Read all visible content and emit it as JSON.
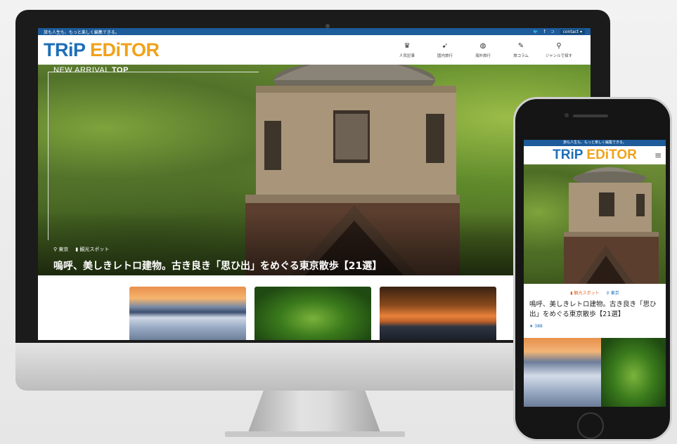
{
  "desktop": {
    "topbar": {
      "tagline": "旅も人生も、もっと楽しく編集できる。",
      "contact": "contact ▾",
      "social_icons": [
        "twitter-icon",
        "facebook-icon",
        "rss-icon"
      ]
    },
    "logo": {
      "part1": "TRiP",
      "part2": "EDiTOR"
    },
    "nav": [
      {
        "label": "人気記事",
        "icon": "popular-icon"
      },
      {
        "label": "国内旅行",
        "icon": "domestic-icon"
      },
      {
        "label": "海外旅行",
        "icon": "globe-icon"
      },
      {
        "label": "旅コラム",
        "icon": "column-icon"
      },
      {
        "label": "ジャンルで探す",
        "icon": "search-icon"
      }
    ],
    "hero": {
      "label_prefix": "NEW ARRIVAL ",
      "label_bold": "TOP",
      "location": "東京",
      "category": "観光スポット",
      "title": "嗚呼、美しきレトロ建物。古き良き「思ひ出」をめぐる東京散歩【21選】"
    }
  },
  "mobile": {
    "topbar": {
      "tagline": "旅も人生も、もっと楽しく編集できる。"
    },
    "logo": {
      "part1": "TRiP",
      "part2": "EDiTOR"
    },
    "menu_icon": "≡",
    "category": "観光スポット",
    "location": "東京",
    "title": "嗚呼、美しきレトロ建物。古き良き「思ひ出」をめぐる東京散歩【21選】",
    "likes": "★ 388"
  }
}
